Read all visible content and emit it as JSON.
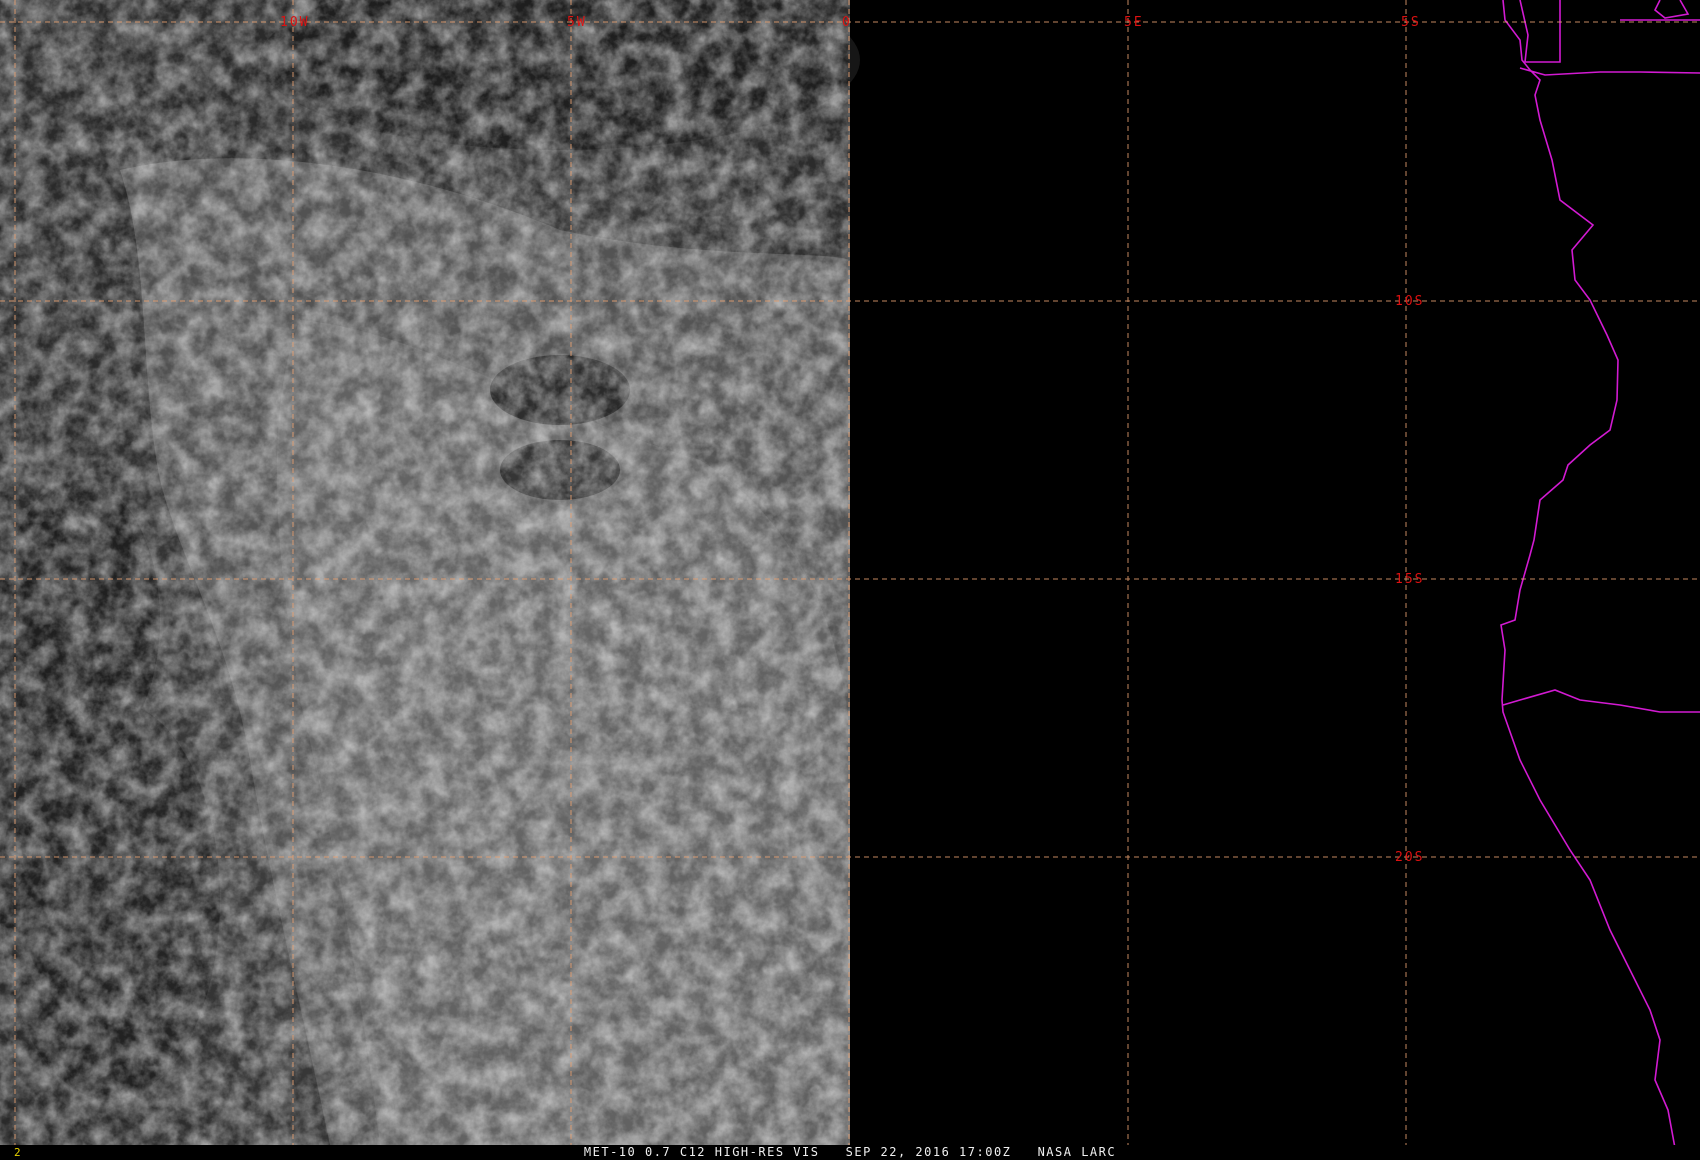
{
  "image": {
    "caption": "MET-10 0.7 C12 HIGH-RES VIS   SEP 22, 2016 17:00Z   NASA LARC",
    "frame_number": "2"
  },
  "grid": {
    "longitude_labels": [
      "10W",
      "5W",
      "0",
      "5E"
    ],
    "latitude_labels": [
      "5S",
      "10S",
      "15S",
      "20S"
    ],
    "line_color": "#e8a070",
    "label_color": "#dd1111"
  },
  "overlays": {
    "coastline_color": "#d21ad2",
    "cloud_imagery": "visible satellite cloud field (grayscale)",
    "data_void": "black region east of 0"
  }
}
